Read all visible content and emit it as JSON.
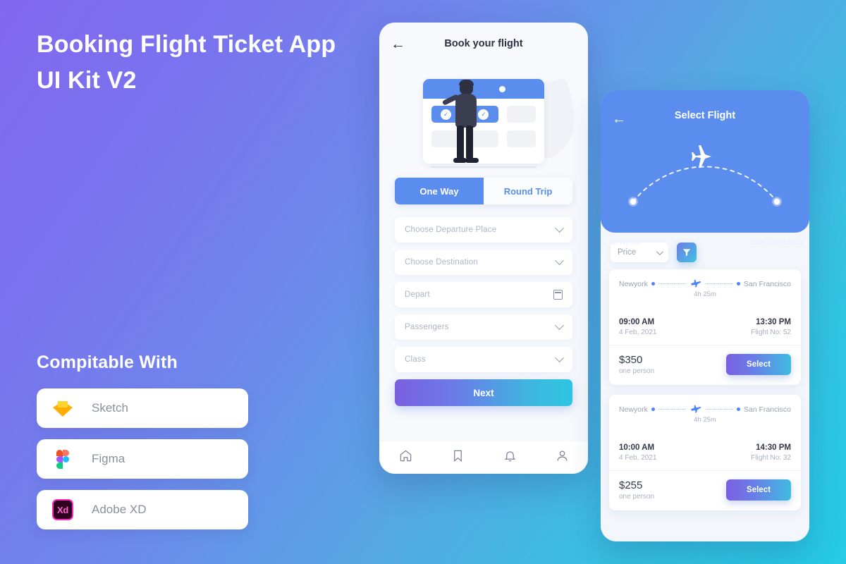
{
  "hero": {
    "title_line1": "Booking Flight Ticket App",
    "title_line2": "UI Kit V2",
    "compat_title": "Compitable With",
    "compat_items": [
      {
        "label": "Sketch",
        "icon": "sketch-icon"
      },
      {
        "label": "Figma",
        "icon": "figma-icon"
      },
      {
        "label": "Adobe XD",
        "icon": "adobe-xd-icon",
        "mark": "Xd"
      }
    ]
  },
  "phone1": {
    "back_icon": "←",
    "title": "Book your flight",
    "trip_tabs": [
      {
        "label": "One Way",
        "active": true
      },
      {
        "label": "Round Trip",
        "active": false
      }
    ],
    "fields": [
      {
        "placeholder": "Choose Departure Place",
        "icon": "chevron-down-icon"
      },
      {
        "placeholder": "Choose Destination",
        "icon": "chevron-down-icon"
      },
      {
        "placeholder": "Depart",
        "icon": "calendar-icon"
      },
      {
        "placeholder": "Passengers",
        "icon": "chevron-down-icon"
      },
      {
        "placeholder": "Class",
        "icon": "chevron-down-icon"
      }
    ],
    "next_label": "Next",
    "nav": [
      {
        "icon": "home-icon"
      },
      {
        "icon": "bookmark-icon"
      },
      {
        "icon": "bell-icon"
      },
      {
        "icon": "person-icon"
      }
    ]
  },
  "phone2": {
    "back_icon": "←",
    "title": "Select Flight",
    "origin": "Newyork",
    "destination": "San Francisco",
    "sort": {
      "label": "Price",
      "icon": "chevron-down-icon"
    },
    "filter_icon": "filter-icon",
    "flights": [
      {
        "origin": "Newyork",
        "destination": "San Francisco",
        "duration": "4h 25m",
        "depart_time": "09:00 AM",
        "depart_date": "4 Feb, 2021",
        "arrive_time": "13:30 PM",
        "flight_no": "Flight No: 52",
        "price": "$350",
        "price_note": "one person",
        "select_label": "Select"
      },
      {
        "origin": "Newyork",
        "destination": "San Francisco",
        "duration": "4h 25m",
        "depart_time": "10:00 AM",
        "depart_date": "4 Feb, 2021",
        "arrive_time": "14:30 PM",
        "flight_no": "Flight No: 32",
        "price": "$255",
        "price_note": "one person",
        "select_label": "Select"
      }
    ]
  },
  "colors": {
    "bg_start": "#8268ef",
    "bg_end": "#25cbe6",
    "primary_blue": "#5b8def",
    "gradient_start": "#7b5fe0",
    "gradient_end": "#2ec6e2"
  }
}
